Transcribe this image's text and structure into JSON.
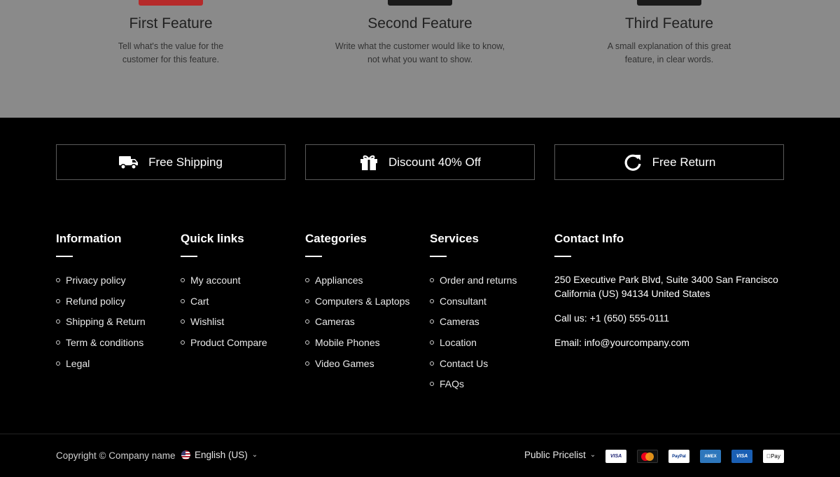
{
  "features": [
    {
      "title": "First Feature",
      "desc": "Tell what's the value for the customer for this feature.",
      "thumb_color": "#b52a2a"
    },
    {
      "title": "Second Feature",
      "desc": "Write what the customer would like to know, not what you want to show.",
      "thumb_color": "#1a1a1a"
    },
    {
      "title": "Third Feature",
      "desc": "A small explanation of this great feature, in clear words.",
      "thumb_color": "#1a1a1a"
    }
  ],
  "perks": [
    {
      "icon": "truck-icon",
      "label": "Free Shipping"
    },
    {
      "icon": "gift-icon",
      "label": "Discount 40% Off"
    },
    {
      "icon": "refresh-icon",
      "label": "Free Return"
    }
  ],
  "columns": {
    "information": {
      "title": "Information",
      "items": [
        "Privacy policy",
        "Refund policy",
        "Shipping & Return",
        "Term & conditions",
        "Legal"
      ]
    },
    "quick_links": {
      "title": "Quick links",
      "items": [
        "My account",
        "Cart",
        "Wishlist",
        "Product Compare"
      ]
    },
    "categories": {
      "title": "Categories",
      "items": [
        "Appliances",
        "Computers & Laptops",
        "Cameras",
        "Mobile Phones",
        "Video Games"
      ]
    },
    "services": {
      "title": "Services",
      "items": [
        "Order and returns",
        "Consultant",
        "Cameras",
        "Location",
        "Contact Us",
        "FAQs"
      ]
    }
  },
  "contact": {
    "title": "Contact Info",
    "address": "250 Executive Park Blvd, Suite 3400 San Francisco California (US) 94134 United States",
    "phone": "Call us: +1 (650) 555-0111",
    "email": "Email: info@yourcompany.com"
  },
  "bottom": {
    "copyright": "Copyright © Company name",
    "language": "English (US)",
    "pricelist": "Public Pricelist"
  },
  "payments": [
    {
      "name": "visa-icon",
      "label": "VISA"
    },
    {
      "name": "mastercard-icon",
      "label": ""
    },
    {
      "name": "paypal-icon",
      "label": "PayPal"
    },
    {
      "name": "amex-icon",
      "label": "AMEX"
    },
    {
      "name": "visa-blue-icon",
      "label": "VISA"
    },
    {
      "name": "applepay-icon",
      "label": "Pay"
    }
  ],
  "colors": {
    "background": "#000000",
    "features_band": "#8a8a8a",
    "perk_border": "#5a5a5a"
  }
}
